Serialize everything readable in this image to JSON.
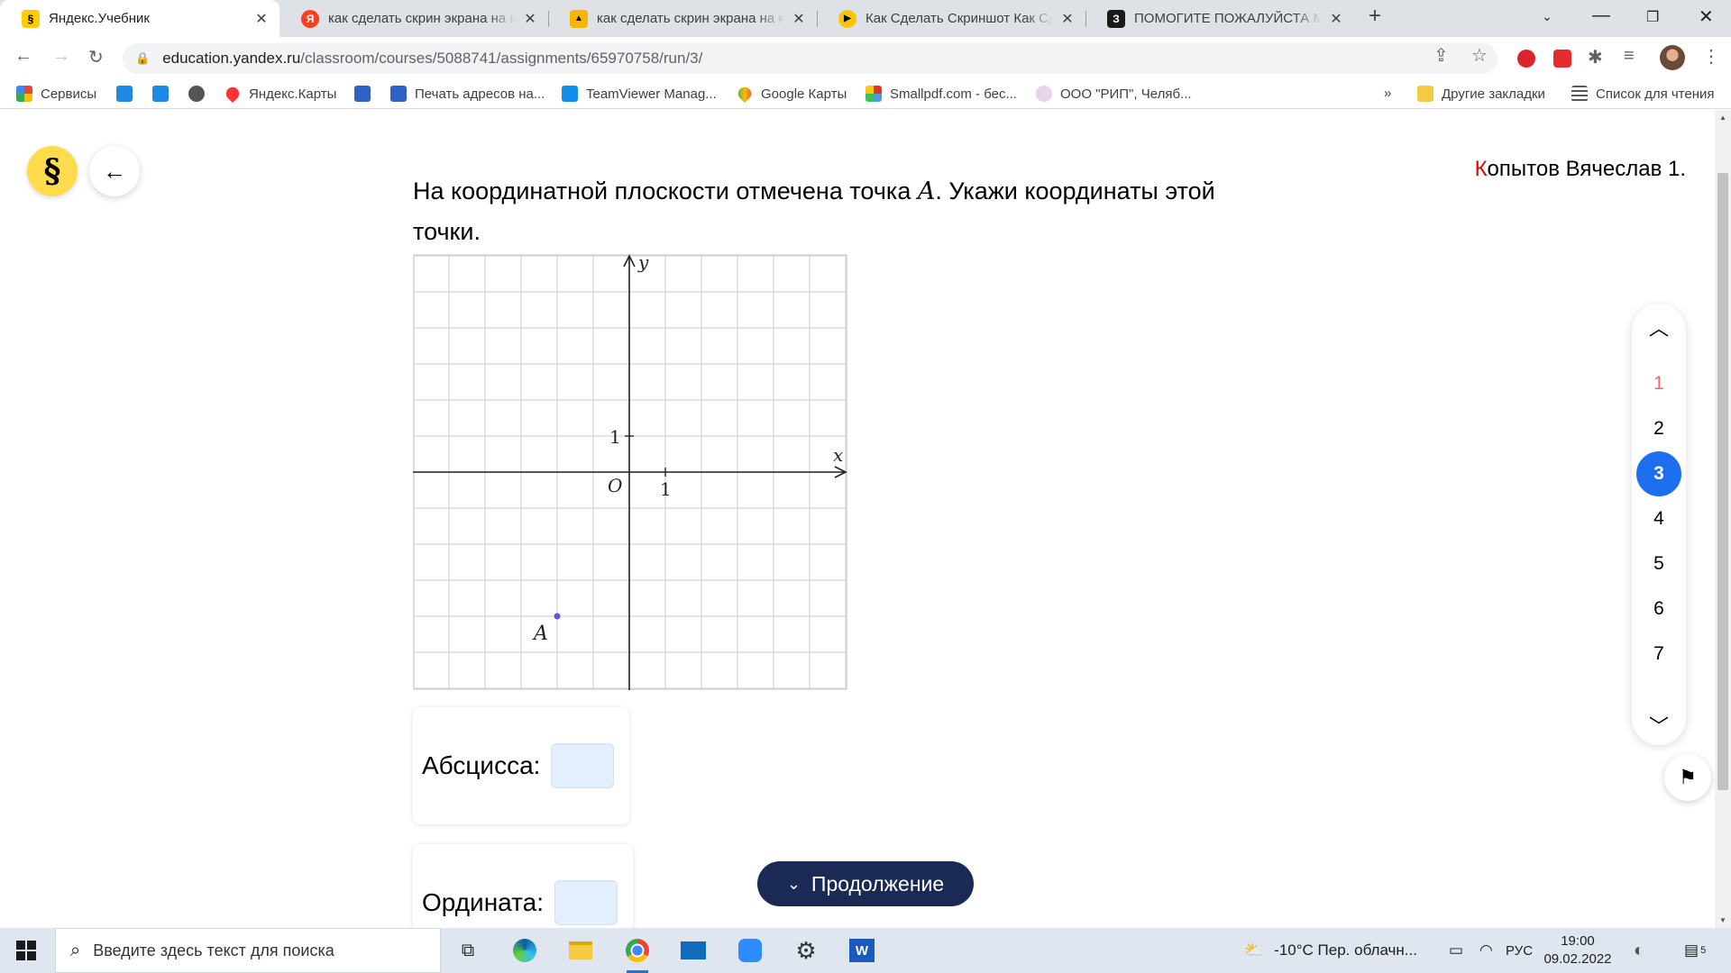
{
  "browser": {
    "tabs": [
      {
        "title": "Яндекс.Учебник",
        "icon": "yandex-uchebnik-icon",
        "color": "#ffcc00",
        "glyph": "§",
        "active": true
      },
      {
        "title": "как сделать скрин экрана на ко",
        "icon": "yandex-icon",
        "color": "#fc3f1d",
        "glyph": "Я",
        "active": false
      },
      {
        "title": "как сделать скрин экрана на ко",
        "icon": "image-icon",
        "color": "#f9b600",
        "glyph": "▲",
        "active": false
      },
      {
        "title": "Как Сделать Скриншот Как Сде",
        "icon": "play-icon",
        "color": "#f7c600",
        "glyph": "▶",
        "active": false
      },
      {
        "title": "ПОМОГИТЕ ПОЖАЛУЙСТА МАТ",
        "icon": "znanija-icon",
        "color": "#1a1a1a",
        "glyph": "З",
        "active": false
      }
    ],
    "url_host": "education.yandex.ru",
    "url_path": "/classroom/courses/5088741/assignments/65970758/run/3/",
    "bookmarks": [
      {
        "label": "Сервисы",
        "icon": "apps-grid-icon",
        "color": "#4285f4"
      },
      {
        "label": "",
        "icon": "card-icon",
        "color": "#1e88e5"
      },
      {
        "label": "",
        "icon": "mail-icon",
        "color": "#1e88e5"
      },
      {
        "label": "",
        "icon": "globe-icon",
        "color": "#555555"
      },
      {
        "label": "Яндекс.Карты",
        "icon": "map-pin-icon",
        "color": "#ff3333"
      },
      {
        "label": "",
        "icon": "envelope-icon",
        "color": "#2f62c4"
      },
      {
        "label": "Печать адресов на...",
        "icon": "envelope-icon",
        "color": "#2f62c4"
      },
      {
        "label": "TeamViewer Manag...",
        "icon": "teamviewer-icon",
        "color": "#0e8ee9"
      },
      {
        "label": "Google Карты",
        "icon": "google-maps-icon",
        "color": "#34a853"
      },
      {
        "label": "Smallpdf.com - бес...",
        "icon": "smallpdf-icon",
        "color": "#e5322d"
      },
      {
        "label": "ООО \"РИП\", Челяб...",
        "icon": "rip-icon",
        "color": "#c8a2c8"
      }
    ],
    "overflow": "»",
    "other_bookmarks": "Другие закладки",
    "reading_list": "Список для чтения"
  },
  "page": {
    "user_name": "Копытов Вячеслав 1.",
    "question_before": "На координатной плоскости отмечена точка ",
    "question_point": "A",
    "question_after": ". Укажи координаты этой точки.",
    "graph": {
      "y_label": "y",
      "x_label": "x",
      "origin_label": "O",
      "x_unit_label": "1",
      "y_unit_label": "1",
      "point_label": "A",
      "x_range": [
        -6,
        6
      ],
      "y_range": [
        -6,
        6
      ],
      "point": {
        "x": -2,
        "y": -4
      },
      "point_color": "#5b5bd6"
    },
    "abscissa_label": "Абсцисса:",
    "ordinate_label": "Ордината:",
    "continue_label": "Продолжение",
    "questions": [
      "1",
      "2",
      "3",
      "4",
      "5",
      "6",
      "7"
    ],
    "current_question": "3",
    "done_questions": [
      "1"
    ]
  },
  "taskbar": {
    "search_placeholder": "Введите здесь текст для поиска",
    "weather": "-10°C  Пер. облачн...",
    "language": "РУС",
    "time": "19:00",
    "date": "09.02.2022",
    "notifications": "5"
  }
}
